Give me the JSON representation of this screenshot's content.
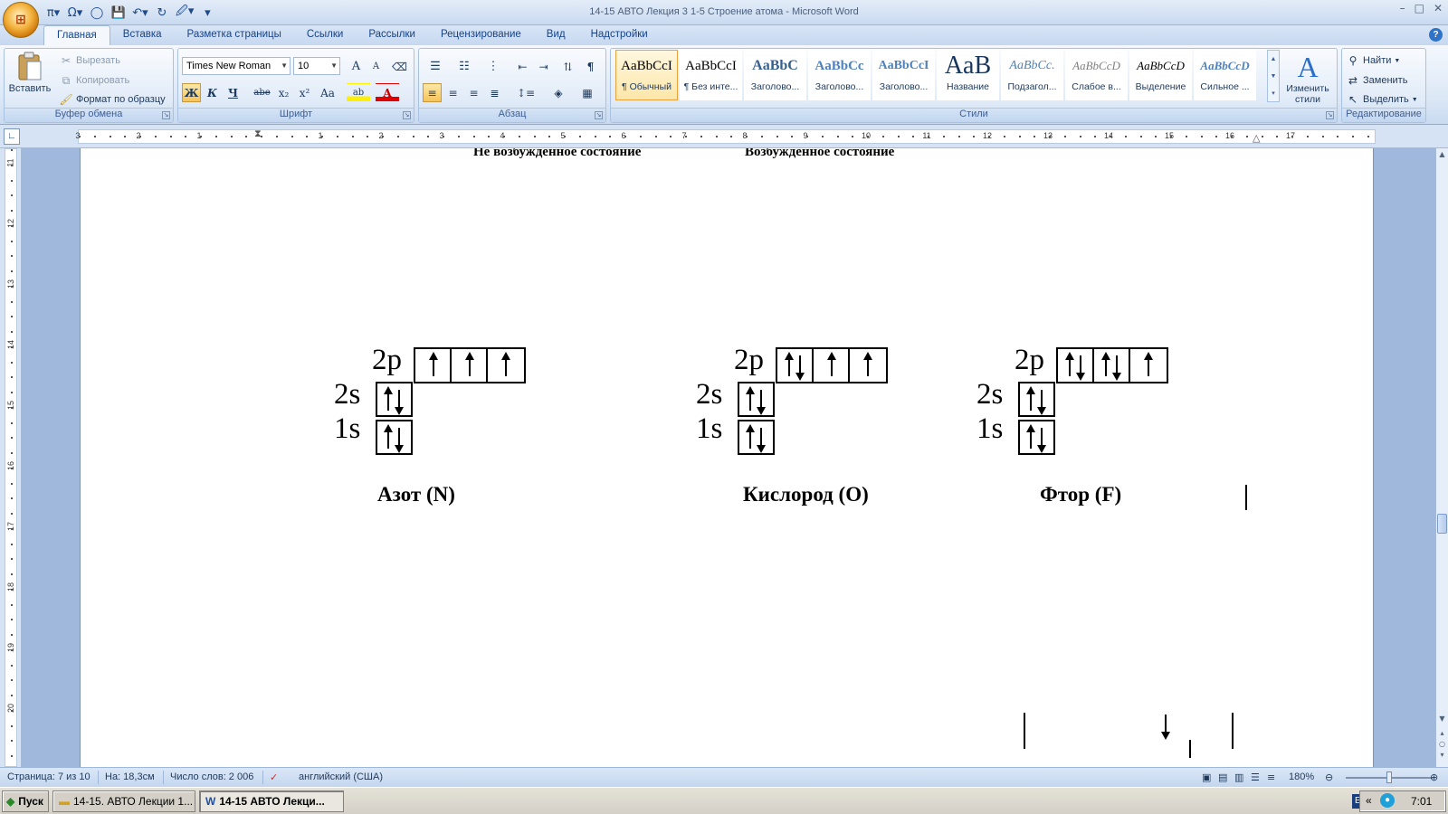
{
  "window": {
    "title": "14-15  АВТО Лекция 3  1-5  Строение  атома - Microsoft Word",
    "controls": [
      "–",
      "□",
      "✕"
    ]
  },
  "qat": [
    "π▾",
    "Ω▾",
    "◯",
    "💾",
    "↶▾",
    "↻",
    "🖉▾",
    "▾"
  ],
  "tabs": [
    "Главная",
    "Вставка",
    "Разметка страницы",
    "Ссылки",
    "Рассылки",
    "Рецензирование",
    "Вид",
    "Надстройки"
  ],
  "clipboard": {
    "paste": "Вставить",
    "cut": "Вырезать",
    "copy": "Копировать",
    "format": "Формат по образцу",
    "group": "Буфер обмена"
  },
  "font": {
    "family": "Times New Roman",
    "size": "10",
    "grow": "A",
    "shrink": "A",
    "bold": "Ж",
    "italic": "К",
    "underline": "Ч",
    "strike": "abe",
    "sub": "x₂",
    "sup": "x²",
    "case": "Aa",
    "highlight": "ab",
    "color": "A",
    "group": "Шрифт"
  },
  "paragraph": {
    "group": "Абзац"
  },
  "styles": {
    "items": [
      {
        "preview": "AaBbCcI",
        "name": "¶ Обычный"
      },
      {
        "preview": "AaBbCcI",
        "name": "¶ Без инте..."
      },
      {
        "preview": "AaBbC",
        "name": "Заголово..."
      },
      {
        "preview": "AaBbCc",
        "name": "Заголово..."
      },
      {
        "preview": "AaBbCcI",
        "name": "Заголово..."
      },
      {
        "preview": "AaB",
        "name": "Название"
      },
      {
        "preview": "AaBbCc.",
        "name": "Подзагол..."
      },
      {
        "preview": "AaBbCcD",
        "name": "Слабое в..."
      },
      {
        "preview": "AaBbCcD",
        "name": "Выделение"
      },
      {
        "preview": "AaBbCcD",
        "name": "Сильное ..."
      }
    ],
    "change": "Изменить стили",
    "group": "Стили"
  },
  "editing": {
    "find": "Найти",
    "replace": "Заменить",
    "select": "Выделить",
    "group": "Редактирование"
  },
  "ruler": {
    "h_numbers": [
      "3",
      "2",
      "1",
      "1",
      "2",
      "3",
      "4",
      "5",
      "6",
      "7",
      "8",
      "9",
      "10",
      "11",
      "12",
      "13",
      "14",
      "15",
      "16",
      "17"
    ],
    "v_numbers": [
      "11",
      "12",
      "13",
      "14",
      "15",
      "16",
      "17",
      "18",
      "19",
      "20"
    ]
  },
  "document": {
    "header_left": "Не возбужденное состояние",
    "header_right": "Возбужденное состояние",
    "orbital_labels": {
      "p": "2p",
      "s2": "2s",
      "s1": "1s"
    },
    "elements": [
      {
        "name": "Азот (N)",
        "p_cells": [
          "↑",
          "↑",
          "↑"
        ],
        "s2": "↑↓",
        "s1": "↑↓"
      },
      {
        "name": "Кислород (O)",
        "p_cells": [
          "↑↓",
          "↑",
          "↑"
        ],
        "s2": "↑↓",
        "s1": "↑↓"
      },
      {
        "name": "Фтор (F)",
        "p_cells": [
          "↑↓",
          "↑↓",
          "↑"
        ],
        "s2": "↑↓",
        "s1": "↑↓"
      }
    ]
  },
  "statusbar": {
    "page": "Страница: 7 из 10",
    "position": "На: 18,3см",
    "words": "Число слов: 2 006",
    "language": "английский (США)",
    "zoom": "180%"
  },
  "taskbar": {
    "start": "Пуск",
    "items": [
      "14-15. АВТО Лекции 1...",
      "14-15   АВТО Лекци..."
    ],
    "lang": "EN",
    "clock": "7:01"
  }
}
